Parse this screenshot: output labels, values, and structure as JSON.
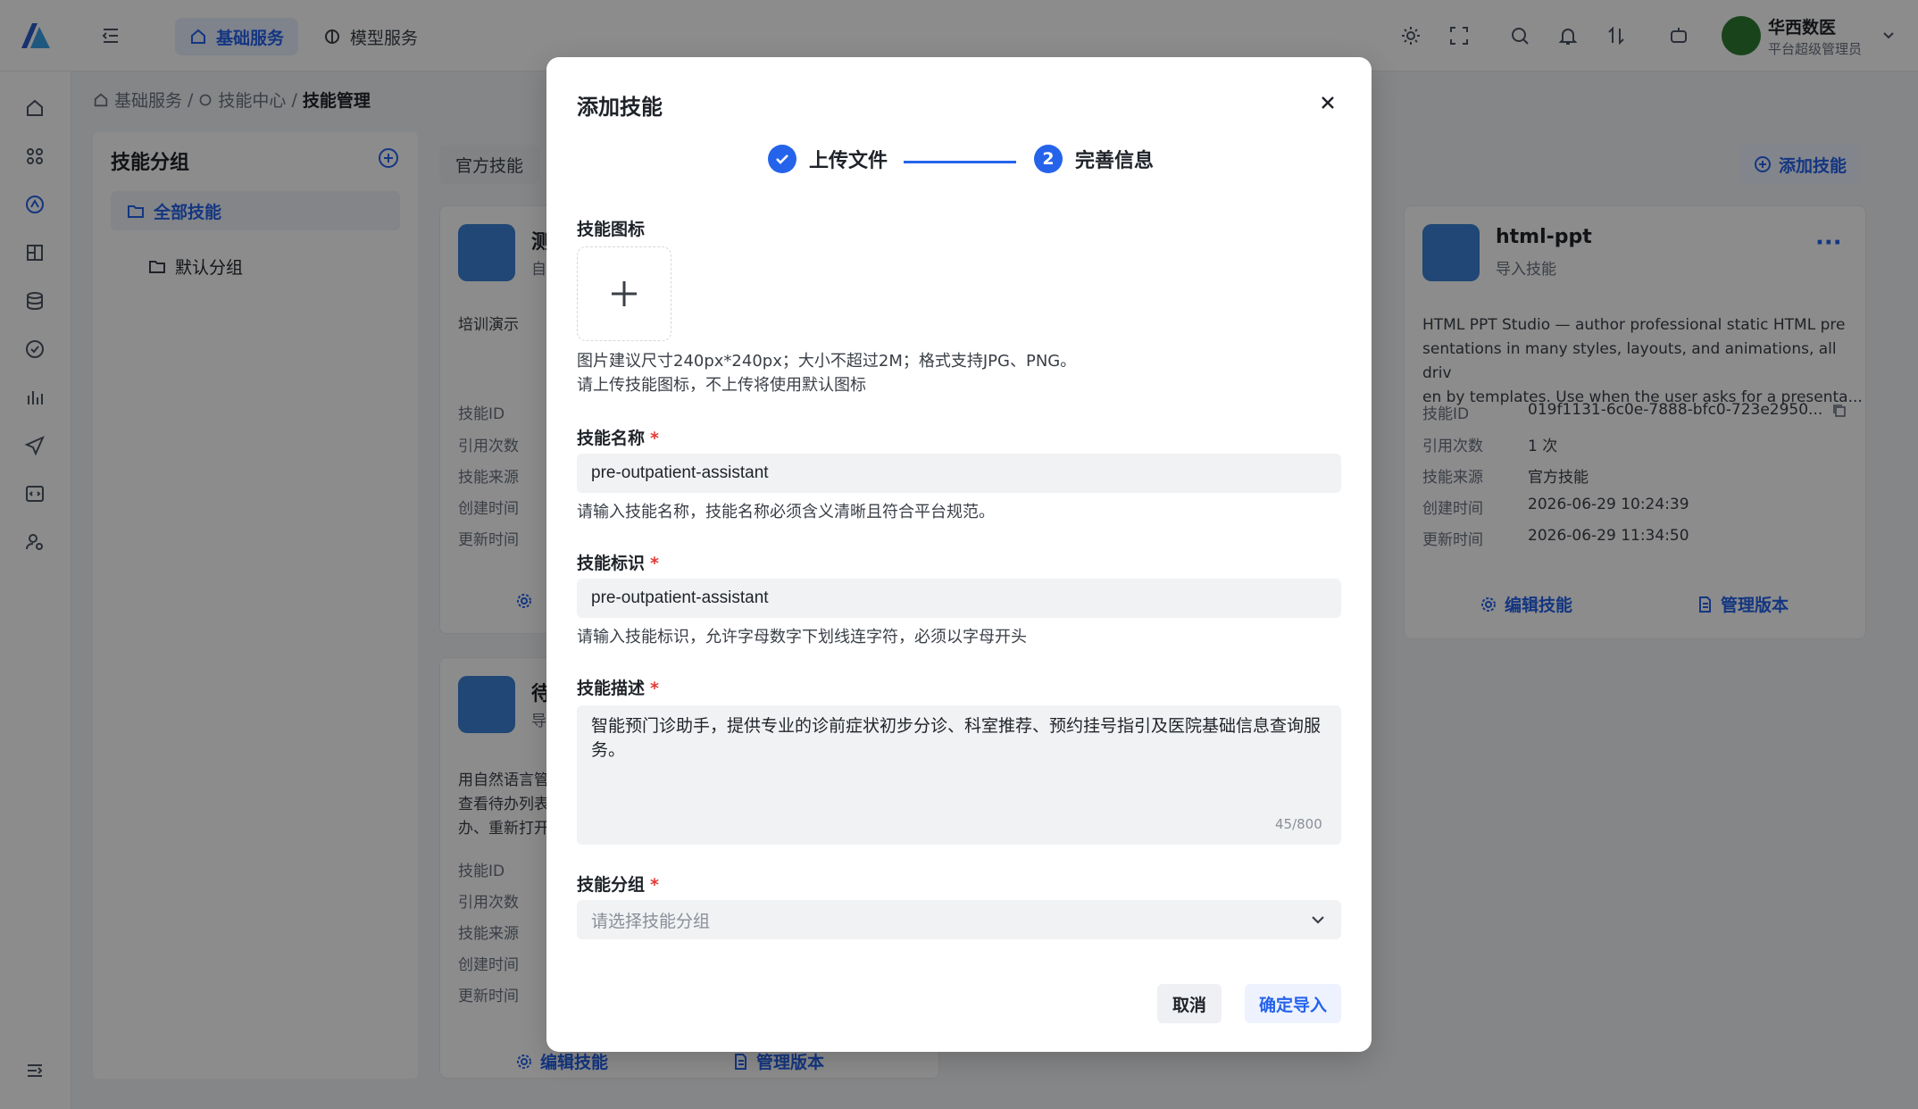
{
  "topbar": {
    "tabs": [
      {
        "label": "基础服务",
        "icon": "home-icon",
        "active": true
      },
      {
        "label": "模型服务",
        "icon": "model-icon",
        "active": false
      }
    ],
    "user": {
      "name": "华西数医",
      "role": "平台超级管理员"
    }
  },
  "breadcrumb": {
    "items": [
      "基础服务",
      "技能中心",
      "技能管理"
    ]
  },
  "groups": {
    "title": "技能分组",
    "items": [
      {
        "label": "全部技能",
        "active": true
      },
      {
        "label": "默认分组",
        "active": false
      }
    ]
  },
  "filter": {
    "active_tab": "官方技能"
  },
  "add_skill_label": "添加技能",
  "cards": [
    {
      "name": "测",
      "sub": "自",
      "desc": "培训演示",
      "meta_labels": [
        "技能ID",
        "引用次数",
        "技能来源",
        "创建时间",
        "更新时间"
      ]
    },
    {
      "name": "待",
      "sub": "导",
      "desc_lines": [
        "用自然语言管",
        "查看待办列表",
        "办、重新打开"
      ],
      "meta_labels": [
        "技能ID",
        "引用次数",
        "技能来源",
        "创建时间",
        "更新时间"
      ],
      "actions": [
        "编辑技能",
        "管理版本"
      ]
    },
    {
      "name": "html-ppt",
      "sub": "导入技能",
      "desc_lines": [
        "HTML PPT Studio — author professional static HTML pre",
        "sentations in many styles, layouts, and animations, all driv",
        "en by templates. Use when the user asks for a presenta..."
      ],
      "meta": [
        {
          "label": "技能ID",
          "value": "019f1131-6c0e-7888-bfc0-723e2950..."
        },
        {
          "label": "引用次数",
          "value": "1 次"
        },
        {
          "label": "技能来源",
          "value": "官方技能"
        },
        {
          "label": "创建时间",
          "value": "2026-06-29 10:24:39"
        },
        {
          "label": "更新时间",
          "value": "2026-06-29 11:34:50"
        }
      ],
      "actions": [
        "编辑技能",
        "管理版本"
      ]
    }
  ],
  "modal": {
    "title": "添加技能",
    "steps": [
      {
        "label": "上传文件",
        "status": "done"
      },
      {
        "label": "完善信息",
        "number": "2",
        "status": "current"
      }
    ],
    "icon_field": {
      "label": "技能图标",
      "hint_lines": [
        "图片建议尺寸240px*240px；大小不超过2M；格式支持JPG、PNG。",
        "请上传技能图标，不上传将使用默认图标"
      ]
    },
    "name_field": {
      "label": "技能名称",
      "value": "pre-outpatient-assistant",
      "hint": "请输入技能名称，技能名称必须含义清晰且符合平台规范。"
    },
    "id_field": {
      "label": "技能标识",
      "value": "pre-outpatient-assistant",
      "hint": "请输入技能标识，允许字母数字下划线连字符，必须以字母开头"
    },
    "desc_field": {
      "label": "技能描述",
      "value": "智能预门诊助手，提供专业的诊前症状初步分诊、科室推荐、预约挂号指引及医院基础信息查询服务。",
      "counter": "45/800"
    },
    "group_field": {
      "label": "技能分组",
      "placeholder": "请选择技能分组"
    },
    "cancel_label": "取消",
    "confirm_label": "确定导入"
  },
  "colors": {
    "accent": "#2563eb",
    "required": "#e53935",
    "overlay": "rgba(0,0,0,0.45)"
  }
}
